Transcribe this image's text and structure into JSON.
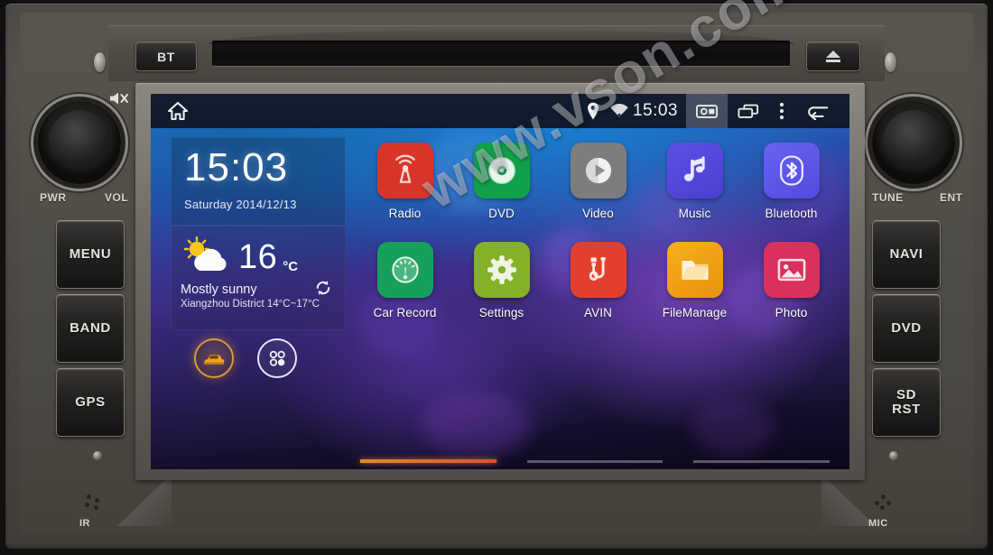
{
  "device": {
    "top_bar": {
      "bt_button": "BT",
      "eject_button": "▲"
    },
    "knobs": {
      "left": {
        "label_left": "PWR",
        "label_right": "VOL"
      },
      "right": {
        "label_left": "TUNE",
        "label_right": "ENT"
      }
    },
    "left_buttons": [
      "MENU",
      "BAND",
      "GPS"
    ],
    "right_buttons": [
      "NAVI",
      "DVD",
      "SD\nRST"
    ],
    "right_buttons_display": [
      {
        "line1": "NAVI",
        "line2": ""
      },
      {
        "line1": "DVD",
        "line2": ""
      },
      {
        "line1": "SD",
        "line2": "RST"
      }
    ],
    "vents": {
      "ir_label": "IR",
      "mic_label": "MIC"
    },
    "mute_icon": "mute-speaker-icon"
  },
  "screen": {
    "statusbar": {
      "home_icon": "home-icon",
      "location_icon": "location-pin-icon",
      "wifi_icon": "wifi-icon",
      "time": "15:03",
      "screenshot_icon": "screenshot-icon",
      "recents_icon": "recents-icon",
      "overflow_icon": "overflow-menu-icon",
      "back_icon": "back-arrow-icon"
    },
    "clock_widget": {
      "time": "15:03",
      "date": "Saturday 2014/12/13"
    },
    "weather_widget": {
      "icon": "sun-behind-cloud-icon",
      "temperature": "16",
      "unit": "°C",
      "condition": "Mostly sunny",
      "location_range": "Xiangzhou District 14°C~17°C",
      "refresh_icon": "refresh-icon"
    },
    "dock": [
      {
        "name": "car-mode-button",
        "icon": "car-icon",
        "color": "#e0962 3"
      },
      {
        "name": "app-drawer-button",
        "icon": "app-drawer-icon",
        "color": "#e8e6f2"
      }
    ],
    "apps": [
      [
        {
          "label": "Radio",
          "icon": "radio-tower-icon",
          "color": "#d8352a"
        },
        {
          "label": "DVD",
          "icon": "disc-icon",
          "color": "#11a14b"
        },
        {
          "label": "Video",
          "icon": "play-circle-icon",
          "color": "#7d7d7d"
        },
        {
          "label": "Music",
          "icon": "music-note-icon",
          "color": "#5b4fe0"
        },
        {
          "label": "Bluetooth",
          "icon": "bluetooth-icon",
          "color": "#5a57e8"
        }
      ],
      [
        {
          "label": "Car Record",
          "icon": "gauge-icon",
          "color": "#17a05c"
        },
        {
          "label": "Settings",
          "icon": "gear-icon",
          "color": "#85b027"
        },
        {
          "label": "AVIN",
          "icon": "av-input-icon",
          "color": "#e2402f"
        },
        {
          "label": "FileManage",
          "icon": "folder-icon",
          "color": "#f0a017"
        },
        {
          "label": "Photo",
          "icon": "photo-icon",
          "color": "#d8315b"
        }
      ]
    ],
    "page_indicator": {
      "pages": 3,
      "active": 1,
      "active_color": "#e0822a"
    },
    "watermark": "www.vson.com"
  }
}
